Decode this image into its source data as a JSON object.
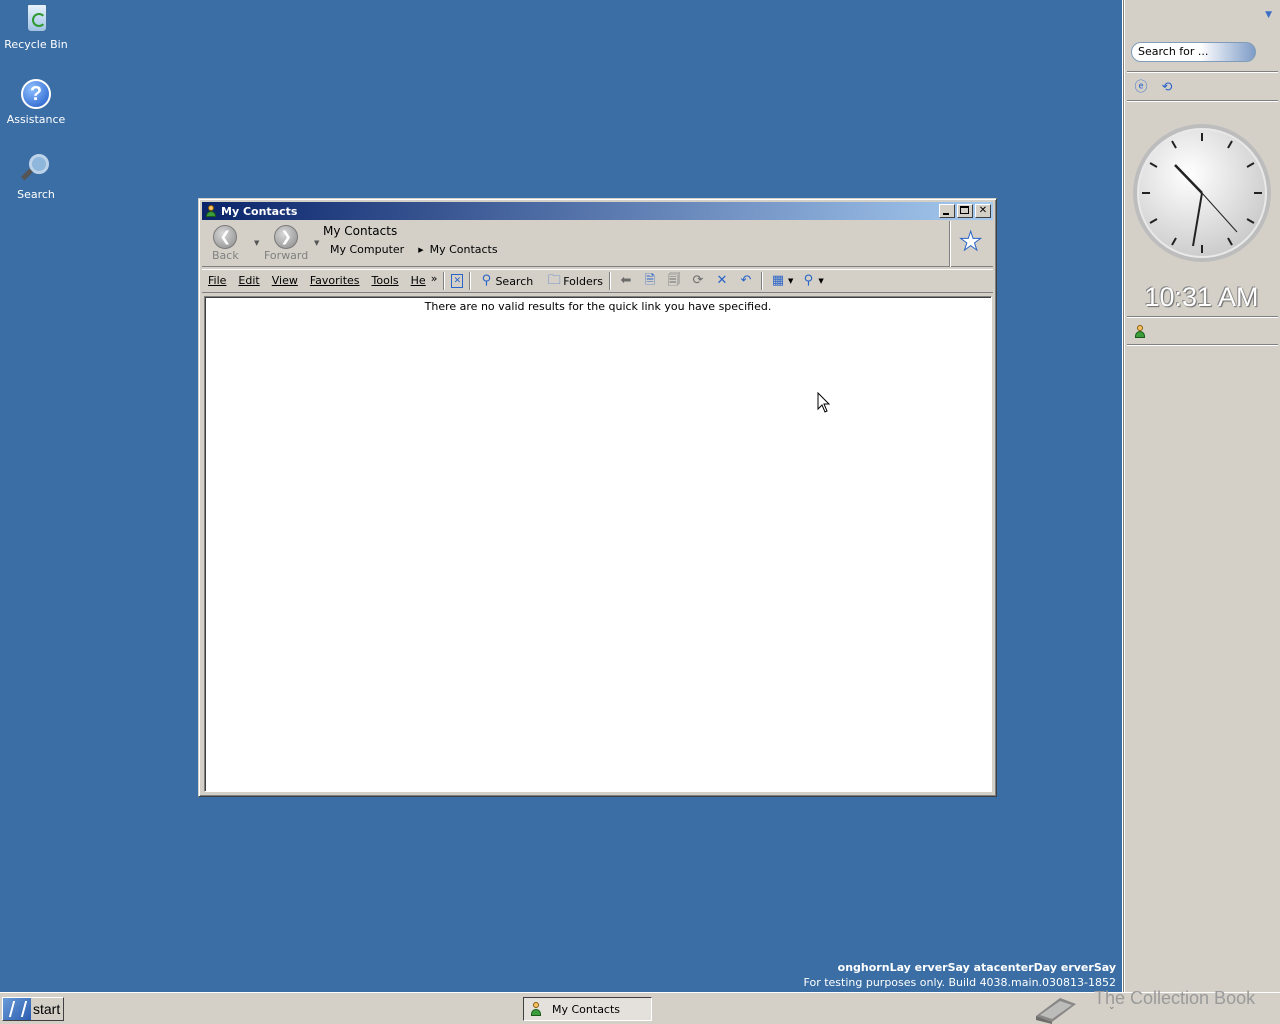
{
  "desktop": {
    "icons": [
      {
        "label": "Recycle Bin",
        "icon": "recycle-bin-icon"
      },
      {
        "label": "Assistance",
        "icon": "help-icon"
      },
      {
        "label": "Search",
        "icon": "search-icon"
      }
    ],
    "watermark_line1": "onghornLay erverSay atacenterDay erverSay",
    "watermark_line2": "For testing purposes only. Build 4038.main.030813-1852"
  },
  "window": {
    "title": "My Contacts",
    "nav": {
      "back_label": "Back",
      "forward_label": "Forward",
      "location_title": "My Contacts",
      "breadcrumb": [
        "My Computer",
        "My Contacts"
      ]
    },
    "menu": [
      "File",
      "Edit",
      "View",
      "Favorites",
      "Tools",
      "He"
    ],
    "menu_more": "»",
    "toolbar": {
      "search_label": "Search",
      "folders_label": "Folders"
    },
    "content_message": "There are no valid results for the quick link you have specified."
  },
  "sidebar": {
    "search_placeholder": "Search for ...",
    "clock_time": "10:31 AM"
  },
  "taskbar": {
    "start_label": "start",
    "task_label": "My Contacts",
    "tray_label": "The Collection Book"
  },
  "colors": {
    "desktop": "#3a6ea5",
    "titlebar_start": "#0a246a",
    "titlebar_end": "#a6caf0",
    "chrome": "#d4d0c8"
  }
}
